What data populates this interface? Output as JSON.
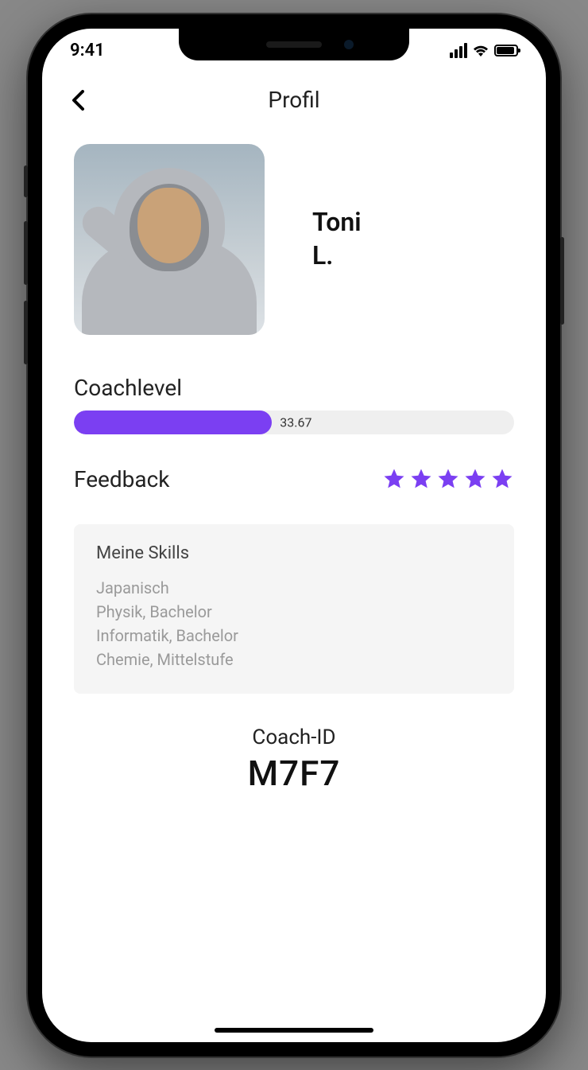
{
  "status": {
    "time": "9:41"
  },
  "nav": {
    "title": "Profil"
  },
  "profile": {
    "first_name": "Toni",
    "last_initial": "L."
  },
  "coachlevel": {
    "label": "Coachlevel",
    "value": "33.67",
    "percent": 45
  },
  "feedback": {
    "label": "Feedback",
    "stars": 5
  },
  "skills": {
    "title": "Meine Skills",
    "items": [
      "Japanisch",
      "Physik, Bachelor",
      "Informatik, Bachelor",
      "Chemie, Mittelstufe"
    ]
  },
  "coach_id": {
    "label": "Coach-ID",
    "value": "M7F7"
  }
}
